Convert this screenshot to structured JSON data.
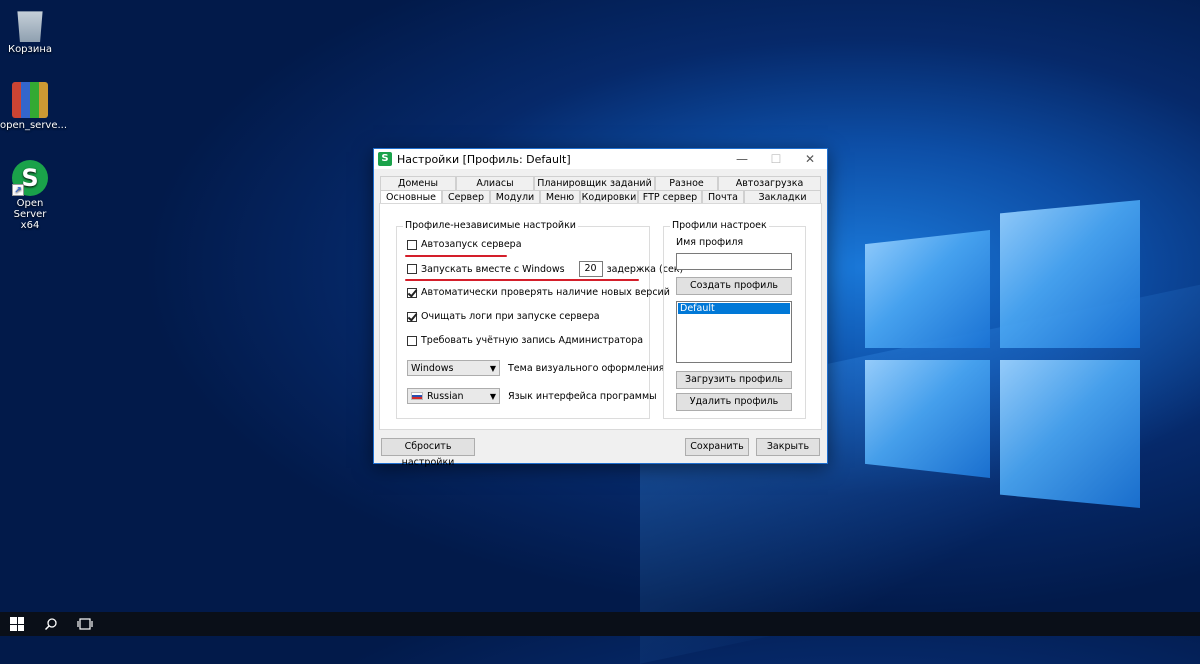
{
  "desktop": {
    "icons": [
      {
        "label": "Корзина"
      },
      {
        "label": "open_serve..."
      },
      {
        "label": "Open Server x64",
        "glyph": "S"
      }
    ]
  },
  "dialog": {
    "title": "Настройки [Профиль: Default]",
    "app_glyph": "S",
    "controls": {
      "minimize": "—",
      "maximize": "☐",
      "close": "✕"
    },
    "tabs_row1": [
      "Домены",
      "Алиасы",
      "Планировщик заданий",
      "Разное",
      "Автозагрузка"
    ],
    "tabs_row2": [
      "Основные",
      "Сервер",
      "Модули",
      "Меню",
      "Кодировки",
      "FTP сервер",
      "Почта",
      "Закладки"
    ],
    "active_tab": "Основные",
    "general_group": {
      "label": "Профиле-независимые настройки",
      "autostart": {
        "label": "Автозапуск сервера",
        "checked": false
      },
      "start_with_windows": {
        "label": "Запускать вместе с Windows",
        "checked": false,
        "delay_value": "20",
        "delay_label": "задержка (сек)"
      },
      "check_updates": {
        "label": "Автоматически проверять наличие новых версий",
        "checked": true
      },
      "clear_logs": {
        "label": "Очищать логи при запуске сервера",
        "checked": true
      },
      "require_admin": {
        "label": "Требовать учётную запись Администратора",
        "checked": false
      },
      "theme": {
        "value": "Windows",
        "label": "Тема визуального оформления"
      },
      "language": {
        "value": "Russian",
        "label": "Язык интерфейса программы"
      }
    },
    "profiles_group": {
      "label": "Профили настроек",
      "name_label": "Имя профиля",
      "name_value": "",
      "create_button": "Создать профиль",
      "list": [
        "Default"
      ],
      "load_button": "Загрузить профиль",
      "delete_button": "Удалить профиль"
    },
    "footer": {
      "reset_button": "Сбросить настройки",
      "save_button": "Сохранить",
      "close_button": "Закрыть"
    }
  },
  "colors": {
    "accent": "#0078d7",
    "annotation": "#d41e2a",
    "start_icon_green": "#1aa24a"
  }
}
